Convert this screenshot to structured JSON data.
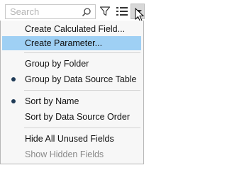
{
  "toolbar": {
    "search_placeholder": "Search",
    "icons": [
      "search-icon",
      "filter-icon",
      "view-options-icon",
      "chevron-down-icon"
    ]
  },
  "menu": {
    "items": [
      {
        "label": "Create Calculated Field...",
        "checked": false,
        "enabled": true,
        "highlighted": false
      },
      {
        "label": "Create Parameter...",
        "checked": false,
        "enabled": true,
        "highlighted": true
      },
      {
        "label": "Group by Folder",
        "checked": false,
        "enabled": true,
        "highlighted": false
      },
      {
        "label": "Group by Data Source Table",
        "checked": true,
        "enabled": true,
        "highlighted": false
      },
      {
        "label": "Sort by Name",
        "checked": true,
        "enabled": true,
        "highlighted": false
      },
      {
        "label": "Sort by Data Source Order",
        "checked": false,
        "enabled": true,
        "highlighted": false
      },
      {
        "label": "Hide All Unused Fields",
        "checked": false,
        "enabled": true,
        "highlighted": false
      },
      {
        "label": "Show Hidden Fields",
        "checked": false,
        "enabled": false,
        "highlighted": false
      }
    ]
  },
  "colors": {
    "highlight": "#9fd0f4",
    "bullet": "#1f3b57",
    "disabled_text": "#8a8a8a"
  }
}
